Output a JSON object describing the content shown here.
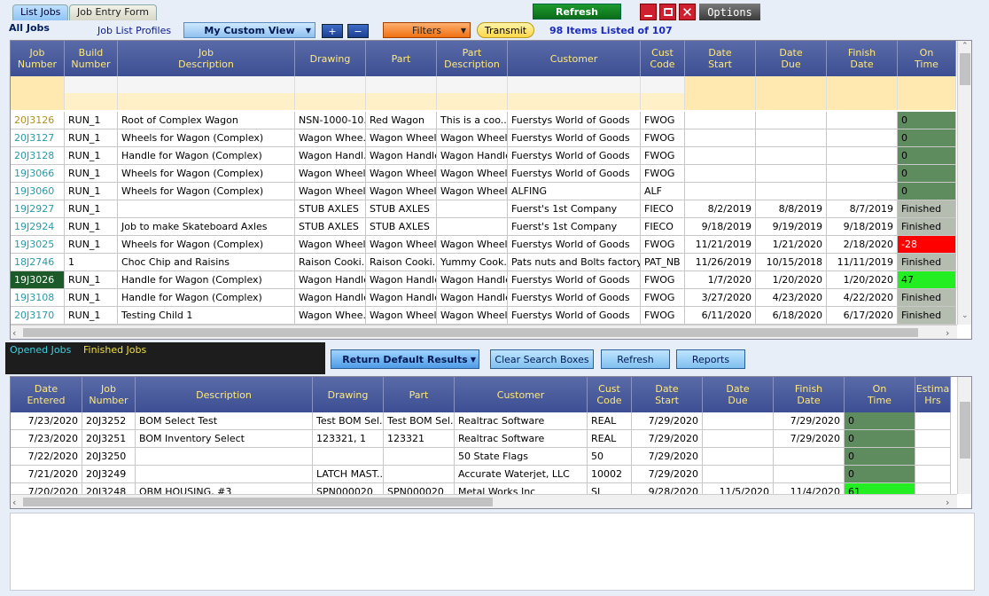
{
  "tabs": [
    "List Jobs",
    "Job Entry Form"
  ],
  "topbar": {
    "refresh": "Refresh",
    "options": "Options"
  },
  "toolbar": {
    "all_jobs": "All Jobs",
    "profiles_label": "Job List Profiles",
    "profile_value": "My Custom View",
    "plus": "+",
    "minus": "−",
    "filters": "Filters",
    "transmit": "Transmit",
    "items_listed": "98 Items Listed of 107"
  },
  "top_grid": {
    "headers": [
      "Job\nNumber",
      "Build\nNumber",
      "Job\nDescription",
      "Drawing",
      "Part",
      "Part\nDescription",
      "Customer",
      "Cust\nCode",
      "Date\nStart",
      "Date\nDue",
      "Finish\nDate",
      "On\nTime"
    ],
    "rows": [
      [
        "20J3126",
        "RUN_1",
        "Root of Complex Wagon",
        "NSN-1000-10...",
        "Red Wagon",
        "This is a coo...",
        "Fuerstys World of Goods",
        "FWOG",
        "",
        "",
        "",
        "0"
      ],
      [
        "20J3127",
        "RUN_1",
        "Wheels for Wagon (Complex)",
        "Wagon Whee...",
        "Wagon Wheels",
        "Wagon Wheels",
        "Fuerstys World of Goods",
        "FWOG",
        "",
        "",
        "",
        "0"
      ],
      [
        "20J3128",
        "RUN_1",
        "Handle for Wagon (Complex)",
        "Wagon Handl...",
        "Wagon Handle",
        "Wagon Handle",
        "Fuerstys World of Goods",
        "FWOG",
        "",
        "",
        "",
        "0"
      ],
      [
        "19J3066",
        "RUN_1",
        "Wheels for Wagon (Complex)",
        "Wagon Wheels",
        "Wagon Wheels",
        "Wagon Wheels",
        "Fuerstys World of Goods",
        "FWOG",
        "",
        "",
        "",
        "0"
      ],
      [
        "19J3060",
        "RUN_1",
        "Wheels for Wagon (Complex)",
        "Wagon Wheels",
        "Wagon Wheels",
        "Wagon Wheels",
        "ALFING",
        "ALF",
        "",
        "",
        "",
        "0"
      ],
      [
        "19J2927",
        "RUN_1",
        "",
        "STUB AXLES",
        "STUB AXLES",
        "",
        "Fuerst's 1st Company",
        "FIECO",
        "8/2/2019",
        "8/8/2019",
        "8/7/2019",
        "Finished"
      ],
      [
        "19J2924",
        "RUN_1",
        "Job to make Skateboard Axles",
        "STUB AXLES",
        "STUB AXLES",
        "",
        "Fuerst's 1st Company",
        "FIECO",
        "9/18/2019",
        "9/19/2019",
        "9/18/2019",
        "Finished"
      ],
      [
        "19J3025",
        "RUN_1",
        "Wheels for Wagon (Complex)",
        "Wagon Wheels",
        "Wagon Wheels",
        "Wagon Wheels",
        "Fuerstys World of Goods",
        "FWOG",
        "11/21/2019",
        "1/21/2020",
        "2/18/2020",
        "-28"
      ],
      [
        "18J2746",
        "1",
        "Choc Chip and Raisins",
        "Raison Cooki...",
        "Raison Cooki...",
        "Yummy Cook...",
        "Pats nuts and Bolts factory",
        "PAT_NB",
        "11/26/2019",
        "10/15/2018",
        "11/11/2019",
        "Finished"
      ],
      [
        "19J3026",
        "RUN_1",
        "Handle for Wagon (Complex)",
        "Wagon Handle",
        "Wagon Handle",
        "Wagon Handle",
        "Fuerstys World of Goods",
        "FWOG",
        "1/7/2020",
        "1/20/2020",
        "1/20/2020",
        "47"
      ],
      [
        "19J3108",
        "RUN_1",
        "Handle for Wagon (Complex)",
        "Wagon Handle",
        "Wagon Handle",
        "Wagon Handle",
        "Fuerstys World of Goods",
        "FWOG",
        "3/27/2020",
        "4/23/2020",
        "4/22/2020",
        "Finished"
      ],
      [
        "20J3170",
        "RUN_1",
        "Testing Child 1",
        "Wagon Whee...",
        "Wagon Wheels",
        "Wagon Wheels",
        "Fuerstys World of Goods",
        "FWOG",
        "6/11/2020",
        "6/18/2020",
        "6/17/2020",
        "Finished"
      ]
    ]
  },
  "legend": {
    "opened": "Opened Jobs",
    "finished": "Finished Jobs"
  },
  "mid": {
    "return_default": "Return Default Results",
    "clear_search": "Clear Search Boxes",
    "refresh": "Refresh",
    "reports": "Reports"
  },
  "bottom_grid": {
    "headers": [
      "Date\nEntered",
      "Job\nNumber",
      "Description",
      "Drawing",
      "Part",
      "Customer",
      "Cust\nCode",
      "Date\nStart",
      "Date\nDue",
      "Finish\nDate",
      "On\nTime",
      "Estima\nHrs"
    ],
    "rows": [
      [
        "7/23/2020",
        "20J3252",
        "BOM Select Test",
        "Test BOM Sel...",
        "Test BOM Sel...",
        "Realtrac Software",
        "REAL",
        "7/29/2020",
        "",
        "7/29/2020",
        "0",
        ""
      ],
      [
        "7/23/2020",
        "20J3251",
        "BOM Inventory Select",
        "123321, 1",
        "123321",
        "Realtrac Software",
        "REAL",
        "7/29/2020",
        "",
        "7/29/2020",
        "0",
        ""
      ],
      [
        "7/22/2020",
        "20J3250",
        "",
        "",
        "",
        "50 State Flags",
        "50",
        "7/29/2020",
        "",
        "",
        "0",
        ""
      ],
      [
        "7/21/2020",
        "20J3249",
        "",
        "LATCH MAST...",
        "",
        "Accurate Waterjet, LLC",
        "10002",
        "7/29/2020",
        "",
        "",
        "0",
        ""
      ],
      [
        "7/20/2020",
        "20J3248",
        "OBM HOUSING, #3",
        "SPN000020",
        "SPN000020",
        "Metal Works Inc",
        "SL",
        "9/28/2020",
        "11/5/2020",
        "11/4/2020",
        "61",
        ""
      ]
    ]
  },
  "colors": {
    "header_bg": "#3d4f93",
    "header_text": "#ffe97a",
    "ontime_green": "#5f8c5f",
    "late_red": "#ff0000",
    "early_green": "#22ee22",
    "finished_gray": "#b5bdb0"
  }
}
